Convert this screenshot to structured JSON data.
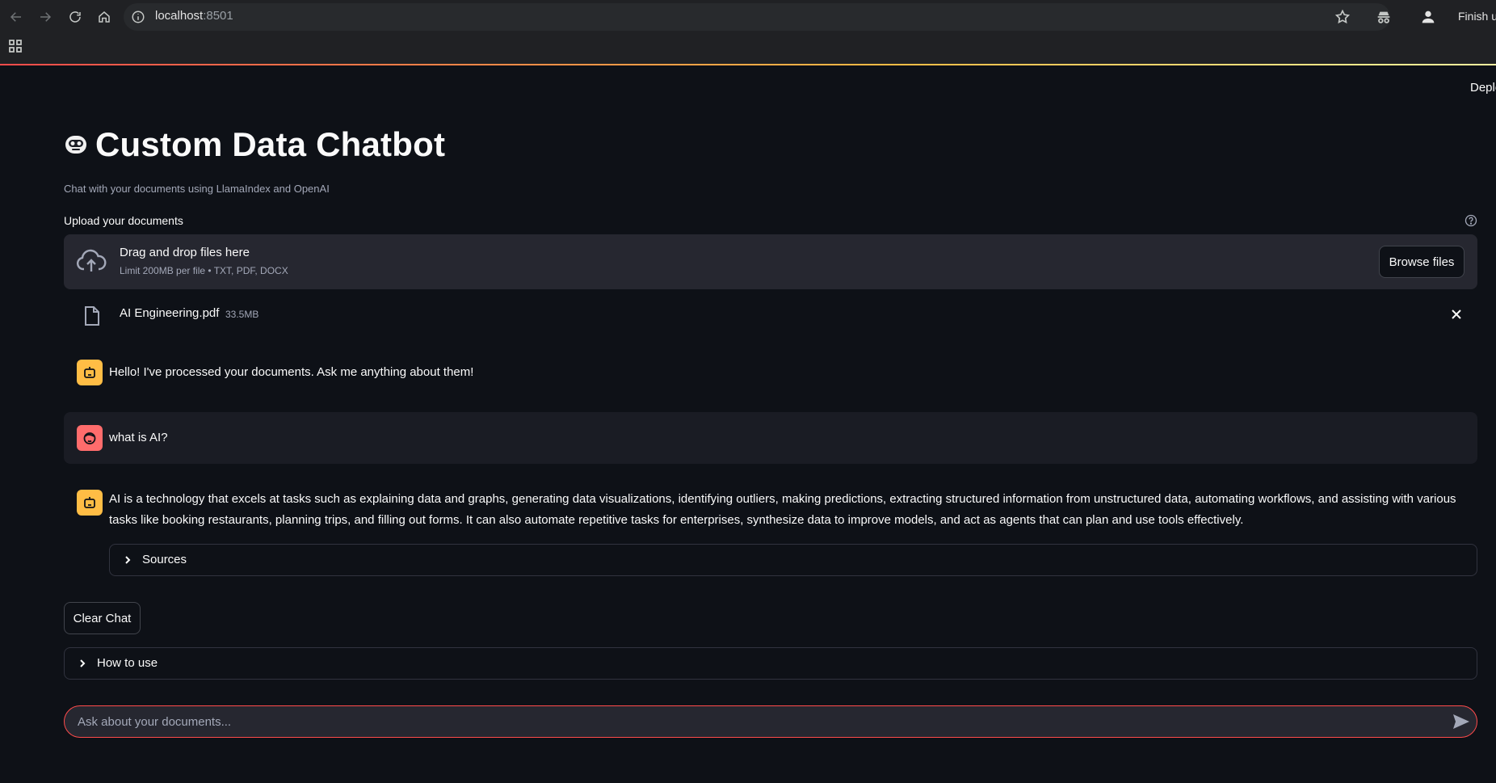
{
  "browser": {
    "url_host": "localhost",
    "url_port": ":8501",
    "finish_label": "Finish up"
  },
  "app": {
    "deploy_label": "Deploy",
    "title": "Custom Data Chatbot",
    "subtitle": "Chat with your documents using LlamaIndex and OpenAI"
  },
  "uploader": {
    "label": "Upload your documents",
    "drop_title": "Drag and drop files here",
    "drop_limit": "Limit 200MB per file • TXT, PDF, DOCX",
    "browse_label": "Browse files",
    "file": {
      "name": "AI Engineering.pdf",
      "size": "33.5MB"
    }
  },
  "chat": {
    "messages": [
      {
        "role": "assistant",
        "text": "Hello! I've processed your documents. Ask me anything about them!"
      },
      {
        "role": "user",
        "text": "what is AI?"
      },
      {
        "role": "assistant",
        "text": "AI is a technology that excels at tasks such as explaining data and graphs, generating data visualizations, identifying outliers, making predictions, extracting structured information from unstructured data, automating workflows, and assisting with various tasks like booking restaurants, planning trips, and filling out forms. It can also automate repetitive tasks for enterprises, synthesize data to improve models, and act as agents that can plan and use tools effectively."
      }
    ],
    "sources_label": "Sources",
    "clear_label": "Clear Chat",
    "how_to_use_label": "How to use",
    "input_placeholder": "Ask about your documents..."
  },
  "colors": {
    "background": "#0e1117",
    "accent": "#ff4b4b",
    "bot_avatar": "#ffbd45",
    "user_avatar": "#ff6c6c"
  }
}
